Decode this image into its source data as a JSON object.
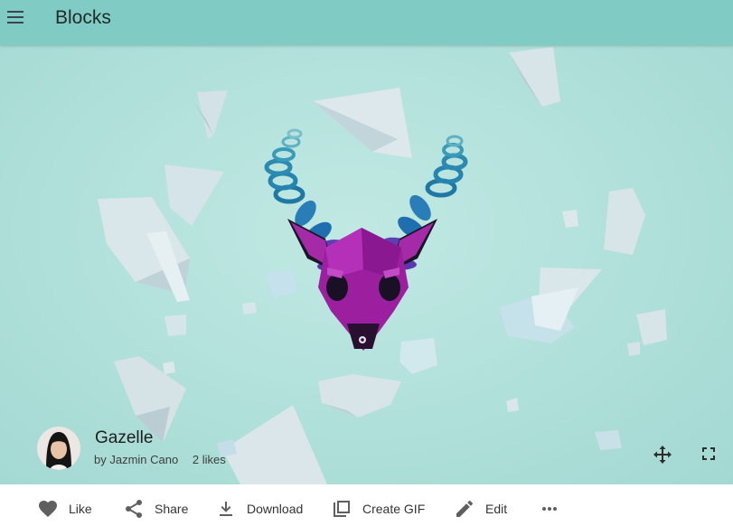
{
  "app": {
    "title": "Blocks",
    "menu_icon": "hamburger-menu-icon"
  },
  "model": {
    "title": "Gazelle",
    "author_prefix": "by",
    "author": "Jazmin Cano",
    "likes": "2 likes",
    "thumbnail": "deer-head-with-blue-spiral-horns"
  },
  "viewer": {
    "move_icon": "move-arrows-icon",
    "fullscreen_icon": "fullscreen-icon"
  },
  "actions": [
    {
      "label": "Like",
      "icon": "heart-icon"
    },
    {
      "label": "Share",
      "icon": "share-icon"
    },
    {
      "label": "Download",
      "icon": "download-icon"
    },
    {
      "label": "Create GIF",
      "icon": "create-gif-icon"
    },
    {
      "label": "Edit",
      "icon": "pencil-icon"
    },
    {
      "label": "",
      "icon": "more-horizontal-icon"
    }
  ],
  "colors": {
    "app_bar": "#80cbc4",
    "viewer_bg": "#b0e0da",
    "deer_head": "#9b1f9e",
    "horn_rings": "#5c3fb5",
    "horn_spirals": "#2a8ab0",
    "crystals": "#d4e5ea",
    "icon": "#5f5f5f"
  }
}
